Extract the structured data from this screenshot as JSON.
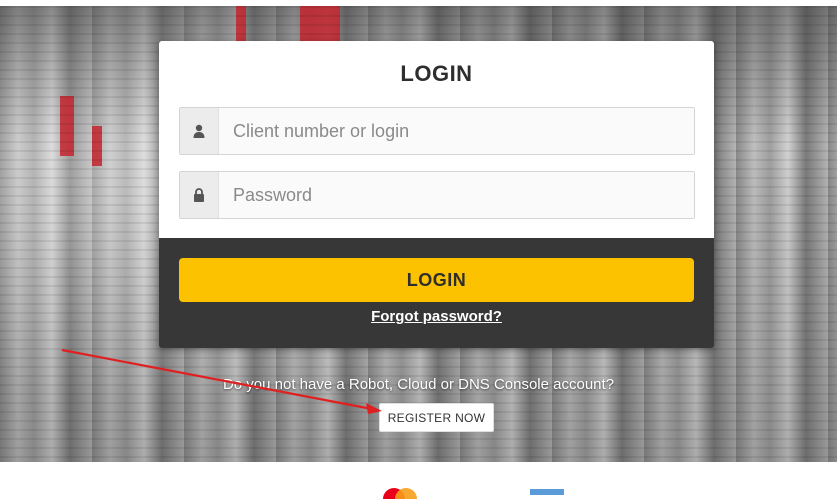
{
  "login": {
    "title": "LOGIN",
    "username_placeholder": "Client number or login",
    "password_placeholder": "Password",
    "submit_label": "LOGIN",
    "forgot_label": "Forgot password?"
  },
  "register": {
    "question": "Do you not have a Robot, Cloud or DNS Console account?",
    "button_label": "REGISTER NOW"
  },
  "colors": {
    "accent": "#fcc200",
    "card_footer": "#373737",
    "annotation_arrow": "#e02020"
  },
  "icons": [
    "user-icon",
    "lock-icon",
    "mastercard-logo",
    "payment-logo"
  ]
}
